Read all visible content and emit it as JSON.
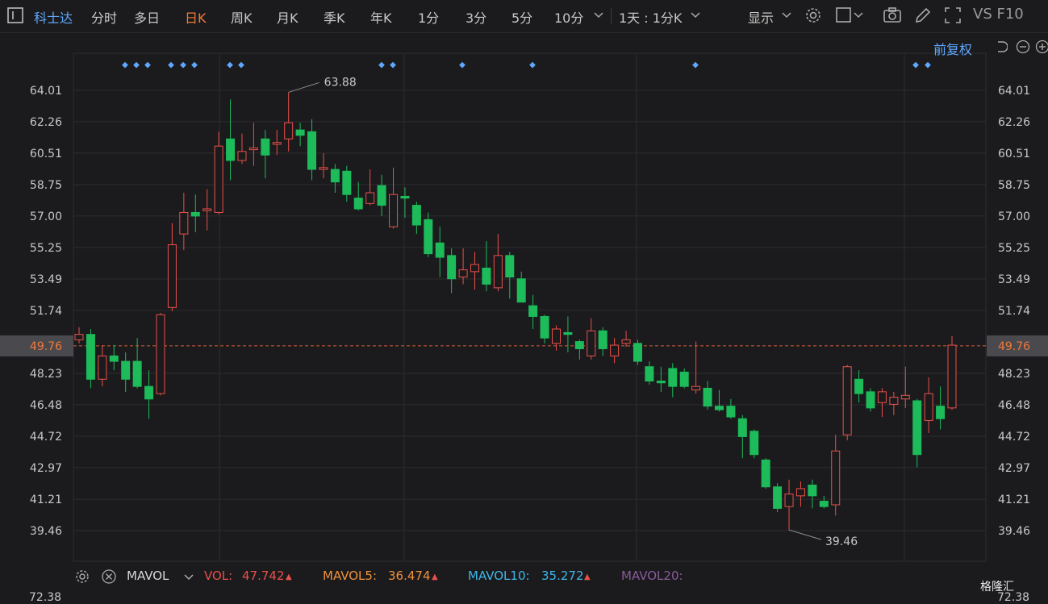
{
  "toolbar": {
    "stock_name": "科士达",
    "periods": [
      "分时",
      "多日",
      "日K",
      "周K",
      "月K",
      "季K",
      "年K",
      "1分",
      "3分",
      "5分",
      "10分"
    ],
    "active_period": "日K",
    "interval_select": "1天 : 1分K",
    "display_label": "显示",
    "f10_label": "VS F10"
  },
  "adjust_label": "前复权",
  "colors": {
    "up": "#e8504a",
    "down": "#1dbb5a",
    "grid": "#2c2c2f",
    "accent": "#5fa8ff",
    "dashed_line": "#d9603a",
    "background": "#1b1b1d"
  },
  "chart_data": {
    "type": "candlestick",
    "ylim": [
      38.6,
      65.0
    ],
    "y_ticks": [
      "64.01",
      "62.26",
      "60.51",
      "58.75",
      "57.00",
      "55.25",
      "53.49",
      "51.74",
      "49.76",
      "48.23",
      "46.48",
      "44.72",
      "42.97",
      "41.21",
      "39.46"
    ],
    "current_price": "49.76",
    "max_label": "63.88",
    "min_label": "39.46",
    "candles": [
      {
        "o": 50.1,
        "c": 50.4,
        "h": 50.8,
        "l": 49.9
      },
      {
        "o": 50.4,
        "c": 47.9,
        "h": 50.7,
        "l": 47.4
      },
      {
        "o": 47.9,
        "c": 49.2,
        "h": 49.8,
        "l": 47.5
      },
      {
        "o": 49.2,
        "c": 48.9,
        "h": 49.8,
        "l": 48.4
      },
      {
        "o": 48.9,
        "c": 47.9,
        "h": 49.4,
        "l": 47.2
      },
      {
        "o": 48.9,
        "c": 47.5,
        "h": 50.2,
        "l": 47.4
      },
      {
        "o": 47.5,
        "c": 46.8,
        "h": 48.4,
        "l": 45.7
      },
      {
        "o": 47.1,
        "c": 51.5,
        "h": 51.6,
        "l": 47.0
      },
      {
        "o": 51.9,
        "c": 55.4,
        "h": 56.6,
        "l": 51.7
      },
      {
        "o": 56.0,
        "c": 57.2,
        "h": 58.3,
        "l": 55.1
      },
      {
        "o": 57.2,
        "c": 57.0,
        "h": 58.2,
        "l": 56.1
      },
      {
        "o": 57.3,
        "c": 57.4,
        "h": 58.5,
        "l": 56.2
      },
      {
        "o": 57.2,
        "c": 60.9,
        "h": 61.7,
        "l": 57.1
      },
      {
        "o": 61.3,
        "c": 60.1,
        "h": 63.5,
        "l": 59.0
      },
      {
        "o": 60.1,
        "c": 60.6,
        "h": 61.6,
        "l": 59.9
      },
      {
        "o": 60.7,
        "c": 60.8,
        "h": 62.2,
        "l": 59.8
      },
      {
        "o": 61.3,
        "c": 60.4,
        "h": 61.8,
        "l": 59.1
      },
      {
        "o": 61.0,
        "c": 61.1,
        "h": 61.8,
        "l": 60.4
      },
      {
        "o": 61.3,
        "c": 62.2,
        "h": 63.9,
        "l": 60.6
      },
      {
        "o": 61.8,
        "c": 61.5,
        "h": 62.2,
        "l": 60.9
      },
      {
        "o": 61.7,
        "c": 59.6,
        "h": 62.4,
        "l": 59.0
      },
      {
        "o": 59.6,
        "c": 59.7,
        "h": 60.5,
        "l": 59.1
      },
      {
        "o": 59.6,
        "c": 58.9,
        "h": 59.9,
        "l": 58.3
      },
      {
        "o": 59.5,
        "c": 58.2,
        "h": 59.8,
        "l": 57.8
      },
      {
        "o": 58.0,
        "c": 57.4,
        "h": 58.9,
        "l": 57.3
      },
      {
        "o": 57.7,
        "c": 58.3,
        "h": 59.6,
        "l": 57.6
      },
      {
        "o": 58.7,
        "c": 57.6,
        "h": 59.3,
        "l": 57.0
      },
      {
        "o": 56.4,
        "c": 58.2,
        "h": 59.7,
        "l": 56.3
      },
      {
        "o": 58.1,
        "c": 58.0,
        "h": 58.6,
        "l": 56.9
      },
      {
        "o": 57.6,
        "c": 56.5,
        "h": 57.8,
        "l": 56.0
      },
      {
        "o": 56.8,
        "c": 54.9,
        "h": 57.2,
        "l": 54.7
      },
      {
        "o": 55.5,
        "c": 54.7,
        "h": 56.4,
        "l": 53.6
      },
      {
        "o": 54.8,
        "c": 53.5,
        "h": 55.2,
        "l": 52.7
      },
      {
        "o": 53.6,
        "c": 54.0,
        "h": 55.2,
        "l": 53.2
      },
      {
        "o": 53.9,
        "c": 54.3,
        "h": 55.0,
        "l": 52.9
      },
      {
        "o": 54.1,
        "c": 53.2,
        "h": 55.6,
        "l": 52.8
      },
      {
        "o": 53.0,
        "c": 54.8,
        "h": 56.0,
        "l": 52.8
      },
      {
        "o": 54.8,
        "c": 53.6,
        "h": 55.0,
        "l": 52.4
      },
      {
        "o": 53.5,
        "c": 52.2,
        "h": 53.9,
        "l": 52.2
      },
      {
        "o": 52.0,
        "c": 51.4,
        "h": 52.6,
        "l": 50.7
      },
      {
        "o": 51.4,
        "c": 50.2,
        "h": 51.5,
        "l": 49.9
      },
      {
        "o": 49.9,
        "c": 50.7,
        "h": 50.9,
        "l": 49.5
      },
      {
        "o": 50.5,
        "c": 50.4,
        "h": 51.4,
        "l": 49.4
      },
      {
        "o": 50.0,
        "c": 49.6,
        "h": 50.1,
        "l": 49.0
      },
      {
        "o": 49.2,
        "c": 50.6,
        "h": 51.3,
        "l": 49.0
      },
      {
        "o": 50.6,
        "c": 49.6,
        "h": 50.8,
        "l": 49.2
      },
      {
        "o": 49.2,
        "c": 49.8,
        "h": 50.2,
        "l": 48.8
      },
      {
        "o": 49.9,
        "c": 50.1,
        "h": 50.6,
        "l": 49.7
      },
      {
        "o": 49.9,
        "c": 48.9,
        "h": 50.1,
        "l": 48.7
      },
      {
        "o": 48.6,
        "c": 47.8,
        "h": 48.9,
        "l": 47.6
      },
      {
        "o": 47.8,
        "c": 47.7,
        "h": 48.6,
        "l": 47.2
      },
      {
        "o": 48.5,
        "c": 47.5,
        "h": 48.8,
        "l": 46.9
      },
      {
        "o": 48.3,
        "c": 47.5,
        "h": 48.5,
        "l": 47.4
      },
      {
        "o": 47.3,
        "c": 47.5,
        "h": 50.0,
        "l": 47.1
      },
      {
        "o": 47.4,
        "c": 46.4,
        "h": 47.8,
        "l": 46.2
      },
      {
        "o": 46.4,
        "c": 46.2,
        "h": 47.3,
        "l": 46.1
      },
      {
        "o": 46.4,
        "c": 45.8,
        "h": 46.8,
        "l": 45.7
      },
      {
        "o": 45.7,
        "c": 44.7,
        "h": 45.9,
        "l": 43.5
      },
      {
        "o": 45.0,
        "c": 43.7,
        "h": 45.1,
        "l": 43.5
      },
      {
        "o": 43.4,
        "c": 41.9,
        "h": 43.5,
        "l": 41.8
      },
      {
        "o": 41.9,
        "c": 40.7,
        "h": 42.1,
        "l": 40.5
      },
      {
        "o": 40.8,
        "c": 41.5,
        "h": 42.3,
        "l": 39.5
      },
      {
        "o": 41.4,
        "c": 41.8,
        "h": 42.2,
        "l": 40.8
      },
      {
        "o": 42.0,
        "c": 41.4,
        "h": 42.3,
        "l": 40.7
      },
      {
        "o": 41.1,
        "c": 40.8,
        "h": 41.4,
        "l": 40.7
      },
      {
        "o": 40.9,
        "c": 43.9,
        "h": 44.8,
        "l": 40.3
      },
      {
        "o": 44.8,
        "c": 48.6,
        "h": 48.7,
        "l": 44.5
      },
      {
        "o": 47.9,
        "c": 47.1,
        "h": 48.4,
        "l": 46.6
      },
      {
        "o": 47.2,
        "c": 46.3,
        "h": 47.4,
        "l": 46.1
      },
      {
        "o": 46.6,
        "c": 47.2,
        "h": 47.4,
        "l": 45.8
      },
      {
        "o": 46.5,
        "c": 46.9,
        "h": 47.2,
        "l": 45.9
      },
      {
        "o": 46.8,
        "c": 47.0,
        "h": 48.6,
        "l": 46.3
      },
      {
        "o": 46.7,
        "c": 43.7,
        "h": 46.8,
        "l": 43.0
      },
      {
        "o": 45.6,
        "c": 47.1,
        "h": 48.0,
        "l": 44.9
      },
      {
        "o": 46.4,
        "c": 45.7,
        "h": 47.5,
        "l": 45.1
      },
      {
        "o": 46.3,
        "c": 49.8,
        "h": 50.3,
        "l": 46.2
      }
    ]
  },
  "volume_bar": {
    "indicator": "MAVOL",
    "vol_label": "VOL:",
    "vol_value": "47.742",
    "mavol5_label": "MAVOL5:",
    "mavol5_value": "36.474",
    "mavol10_label": "MAVOL10:",
    "mavol10_value": "35.272",
    "mavol20_label": "MAVOL20:",
    "cut_tick": "72.38"
  },
  "watermark": "格隆汇"
}
